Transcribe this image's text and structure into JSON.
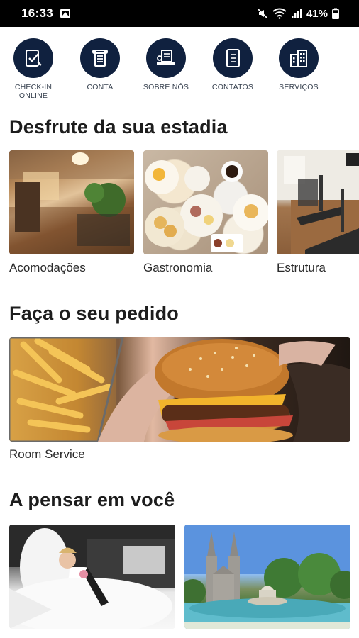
{
  "status_bar": {
    "time": "16:33",
    "battery": "41%"
  },
  "quick_actions": [
    {
      "label": "CHECK-IN\nONLINE",
      "icon": "checkin-icon"
    },
    {
      "label": "CONTA",
      "icon": "bill-icon"
    },
    {
      "label": "SOBRE NÓS",
      "icon": "hotel-desk-icon"
    },
    {
      "label": "CONTATOS",
      "icon": "contacts-book-icon"
    },
    {
      "label": "SERVIÇOS",
      "icon": "building-icon"
    }
  ],
  "sections": {
    "enjoy": {
      "title": "Desfrute da sua estadia",
      "cards": [
        {
          "label": "Acomodações",
          "image": "room-photo"
        },
        {
          "label": "Gastronomia",
          "image": "food-photo"
        },
        {
          "label": "Estrutura",
          "image": "gym-photo"
        }
      ]
    },
    "order": {
      "title": "Faça o seu pedido",
      "cards": [
        {
          "label": "Room Service",
          "image": "burger-photo"
        }
      ]
    },
    "thinking": {
      "title": "A pensar em você",
      "cards": [
        {
          "label": "",
          "image": "wedding-photo"
        },
        {
          "label": "",
          "image": "church-photo"
        }
      ]
    }
  },
  "colors": {
    "accent": "#10213f",
    "text": "#1d1d1d",
    "muted": "#37414f"
  }
}
